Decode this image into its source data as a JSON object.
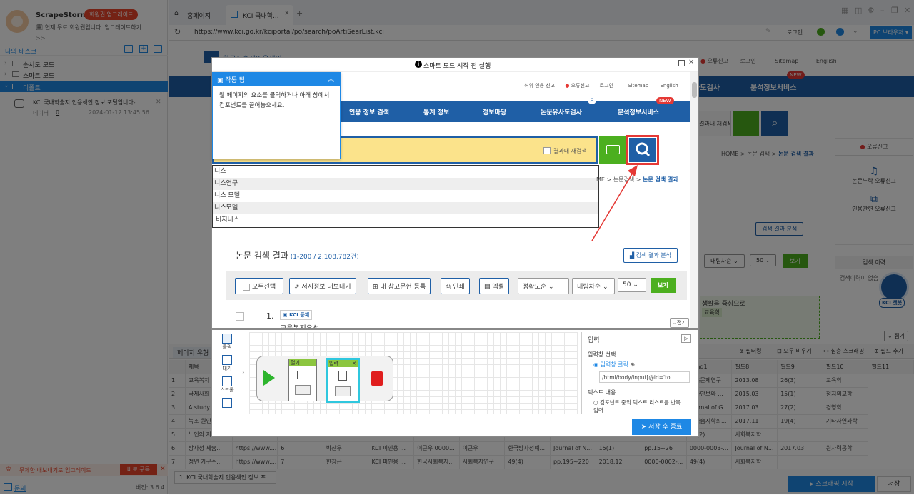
{
  "sidebar": {
    "app_name": "ScrapeStorm",
    "upgrade_badge": "회원권 업그레이드",
    "subtitle": "현재 무료 회원권입니다. 업그레이드하기",
    "more": ">>",
    "my_tasks": "나의 태스크",
    "folders": [
      {
        "label": "순서도 모드"
      },
      {
        "label": "스마트 모드"
      },
      {
        "label": "디폴트"
      }
    ],
    "task": {
      "title": "KCI 국내학술지 인용색인 정보 포털입니다-...",
      "data_label": "데이터",
      "data_count": "0",
      "date": "2024-01-12 13:45:56"
    },
    "promo_text": "무제한 내보내기로 업그레이드",
    "promo_button": "바로 구독",
    "help": "문의",
    "version": "버전: 3.6.4"
  },
  "browser": {
    "tabs": [
      {
        "label": "홈페이지"
      },
      {
        "label": "KCI 국내학..."
      }
    ],
    "url": "https://www.kci.go.kr/kciportal/po/search/poArtiSearList.kci",
    "login": "로그인",
    "pc_browser": "PC 브라우저"
  },
  "bg_site": {
    "logo_text": "한국학술지인용색인",
    "top_links": [
      "허위 인용 신고",
      "오류신고",
      "로그인",
      "Sitemap",
      "English"
    ],
    "nav": [
      "논문유사도검사",
      "분석정보서비스"
    ],
    "new_badge": "NEW",
    "search_within": "결과내 재검색",
    "breadcrumb": [
      "HOME",
      "논문 검색",
      "논문 검색 결과"
    ],
    "error_report": "오류신고",
    "side_links": [
      "논문누락 오류신고",
      "인용관련 오류신고"
    ],
    "analysis_btn": "검색 결과 분석",
    "sort": "내림차순",
    "per_page": "50",
    "view": "보기",
    "history_title": "검색 이력",
    "history_text": "검색이력이 없습",
    "chatbot": "KCI 챗봇",
    "result_snippet": "생활을 중심으로",
    "result_snippet2": "교육학",
    "collapse": "접기"
  },
  "data_panel": {
    "page_type_tab": "페이지 유형",
    "toolbar": [
      "필터링",
      "모두 비우기",
      "심층 스크래핑",
      "필드 추가"
    ],
    "columns": [
      "제목",
      "",
      "",
      "",
      "",
      "",
      "",
      "",
      "",
      "",
      "",
      "blind1",
      "필드8",
      "필드9",
      "필드10",
      "필드11"
    ],
    "rows": [
      [
        "1",
        "교육복지",
        "",
        "",
        "",
        "",
        "",
        "",
        "",
        "",
        "",
        "0000-0002-...",
        "교육문제연구",
        "2013.08",
        "26(3)",
        "교육학"
      ],
      [
        "2",
        "국제사회",
        "",
        "",
        "",
        "",
        "",
        "",
        "",
        "",
        "",
        "0000-0002-...",
        "국가안보와 ...",
        "2015.03",
        "15(1)",
        "정치외교학"
      ],
      [
        "3",
        "A study o",
        "",
        "",
        "",
        "",
        "",
        "",
        "",
        "",
        "",
        "0000-0002-...",
        "Journal of G...",
        "2017.03",
        "27(2)",
        "경영학"
      ],
      [
        "4",
        "녹조 원인",
        "",
        "",
        "",
        "",
        "",
        "",
        "",
        "",
        "",
        "0000-0002-...",
        "한국습지학회...",
        "2017.11",
        "19(4)",
        "기타자연과학"
      ],
      [
        "5",
        "노인의 저",
        "",
        "",
        "",
        "",
        "",
        "",
        "",
        "",
        "",
        "0000-0002-...",
        "37(2)",
        "사회복지학",
        "",
        ""
      ],
      [
        "6",
        "방사성 세슘...",
        "https://www....",
        "6",
        "박찬우",
        "KCI 피인용 ...",
        "이근우 0000...",
        "이근우",
        "한국방사성폐...",
        "Journal of N...",
        "15(1)",
        "pp.15~26",
        "0000-0003-...",
        "Journal of N...",
        "2017.03",
        "원자력공학"
      ],
      [
        "7",
        "청년 가구주...",
        "https://www....",
        "7",
        "한창근",
        "KCI 피인용 ...",
        "한국사회복지...",
        "사회복지연구",
        "49(4)",
        "pp.195~220",
        "2018.12",
        "0000-0002-...",
        "49(4)",
        "사회복지학",
        "",
        ""
      ]
    ],
    "bottom_tab": "1. KCI 국내학술지 인용색인 정보 포...",
    "start_button": "스크래핑 시작",
    "save_button": "저장"
  },
  "modal": {
    "title": "스마트 모드 시작 전 실행",
    "tip_title": "작동 팁",
    "tip_text": "웹 페이지의 요소를 클릭하거나 아래 창에서 컴포넌트를 끌어놓으세요.",
    "inner_links": [
      "허위 인용 신고",
      "오류신고",
      "로그인",
      "Sitemap",
      "English"
    ],
    "inner_nav": [
      "인용 정보 검색",
      "통계 정보",
      "정보마당",
      "논문유사도검사",
      "분석정보서비스"
    ],
    "new_badge": "NEW",
    "search_within": "결과내 재검색",
    "autocomplete": [
      "니스",
      "니스연구",
      "니스 모델",
      "니스모델",
      "비지니스"
    ],
    "breadcrumb_partial": "ME > 논문검색 > ",
    "breadcrumb_current": "논문 검색 결과",
    "results_title": "논문 검색 결과",
    "results_count": "(1-200 / 2,108,782건)",
    "analysis_btn": "검색 결과 분석",
    "toolbar": [
      "모두선택",
      "서지정보 내보내기",
      "내 참고문헌 등록",
      "인쇄",
      "엑셀"
    ],
    "sort_options": [
      "정확도순",
      "내림차순",
      "50"
    ],
    "view": "보기",
    "result_no": "1.",
    "kci_badge": "KCI 등재",
    "result_snippet": "교육복지우선",
    "collapse": "접기",
    "palette": [
      "클릭",
      "대기",
      "스크롤",
      ""
    ],
    "flow_nodes": [
      "열기",
      "입력"
    ],
    "props_title": "입력",
    "input_select_label": "입력창 선택",
    "input_click": "입력창 클릭",
    "xpath": "/html/body/input[@id='to",
    "text_content_label": "텍스트 내용",
    "text_option": "컴포넌트 중의 텍스트 리스트를 반복 입력",
    "save_end": "저장 후 종료"
  },
  "colors": {
    "kci_blue": "#1f5fa6",
    "accent": "#1e88e5",
    "green": "#4caf1f",
    "red": "#e53935"
  }
}
